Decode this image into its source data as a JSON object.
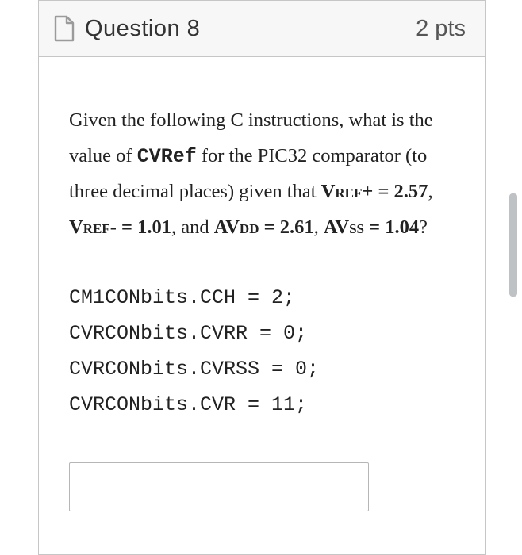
{
  "header": {
    "title": "Question 8",
    "points": "2 pts",
    "icon": "document-icon"
  },
  "body": {
    "prompt": {
      "pre": "Given the following C instructions, what is the value of ",
      "cvref": "CVRef",
      "mid1": " for the PIC32 comparator (to three decimal places) given that ",
      "vrefp_label": "Vref+",
      "vrefp_eq": " = 2.57",
      "comma1": ", ",
      "vrefm_label": "Vref-",
      "vrefm_eq": " = 1.01",
      "and": ", and ",
      "avdd_label": "AVdd",
      "avdd_eq": " = 2.61",
      "comma2": ", ",
      "avss_label": "AVss",
      "avss_eq": " = 1.04",
      "qmark": "?"
    },
    "code": {
      "l1": "CM1CONbits.CCH = 2;",
      "l2": "CVRCONbits.CVRR = 0;",
      "l3": "CVRCONbits.CVRSS = 0;",
      "l4": "CVRCONbits.CVR = 11;"
    },
    "answer_placeholder": ""
  }
}
